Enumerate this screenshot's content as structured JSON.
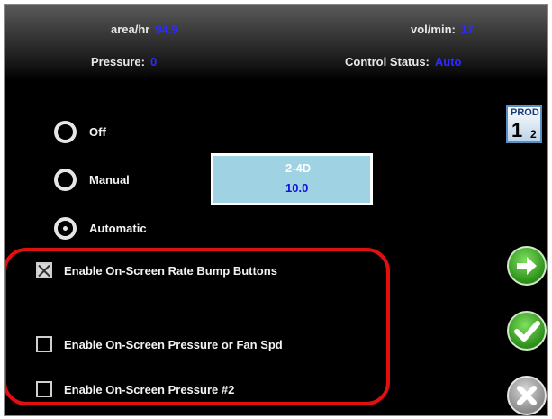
{
  "header": {
    "area_label": "area/hr",
    "area_value": "94.9",
    "vol_label": "vol/min:",
    "vol_value": "17",
    "pressure_label": "Pressure:",
    "pressure_value": "0",
    "control_label": "Control Status:",
    "control_value": "Auto"
  },
  "modes": [
    {
      "label": "Off",
      "selected": false
    },
    {
      "label": "Manual",
      "selected": false
    },
    {
      "label": "Automatic",
      "selected": true
    }
  ],
  "product": {
    "name": "2-4D",
    "rate": "10.0"
  },
  "product_icon": {
    "label": "PROD",
    "number": "1",
    "count": "2"
  },
  "options": [
    {
      "label": "Enable On-Screen Rate Bump Buttons",
      "checked": true
    },
    {
      "label": "Enable On-Screen Pressure or Fan Spd",
      "checked": false
    },
    {
      "label": "Enable On-Screen Pressure #2",
      "checked": false
    }
  ],
  "icons": {
    "next": "arrow-right-icon",
    "accept": "checkmark-icon",
    "cancel": "close-icon"
  },
  "colors": {
    "value_blue": "#2c2cff",
    "highlight_red": "#e01010",
    "product_box": "#9fd3e3",
    "accept_green": "#2c8f1a"
  }
}
